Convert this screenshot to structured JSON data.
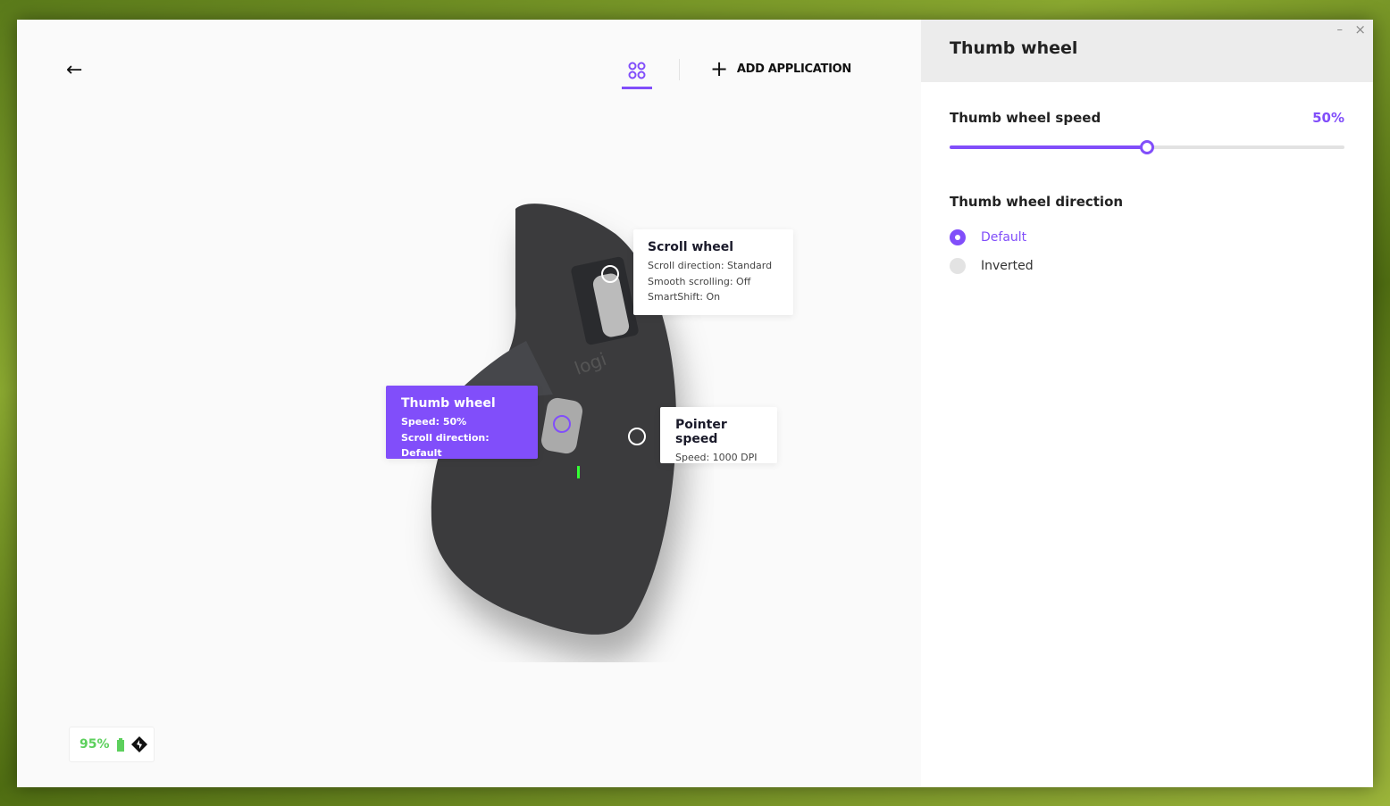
{
  "header": {
    "back_icon": "arrow-left-icon",
    "apps_icon": "four-circles-icon",
    "add_application": "ADD APPLICATION"
  },
  "accent": "#814efa",
  "callouts": {
    "scroll_wheel": {
      "title": "Scroll wheel",
      "lines": [
        "Scroll direction: Standard",
        "Smooth scrolling: Off",
        "SmartShift: On"
      ]
    },
    "thumb_wheel": {
      "title": "Thumb wheel",
      "lines": [
        "Speed: 50%",
        "Scroll direction: Default"
      ]
    },
    "pointer_speed": {
      "title": "Pointer speed",
      "lines": [
        "Speed: 1000 DPI"
      ]
    }
  },
  "device_logo": "logi",
  "battery": {
    "percent": "95%",
    "color": "#5cd05c"
  },
  "panel": {
    "title": "Thumb wheel",
    "speed_label": "Thumb wheel speed",
    "speed_value": "50%",
    "speed_fraction": 0.5,
    "direction_label": "Thumb wheel direction",
    "options": [
      {
        "label": "Default",
        "selected": true
      },
      {
        "label": "Inverted",
        "selected": false
      }
    ],
    "minimize": "–",
    "close": "×"
  }
}
